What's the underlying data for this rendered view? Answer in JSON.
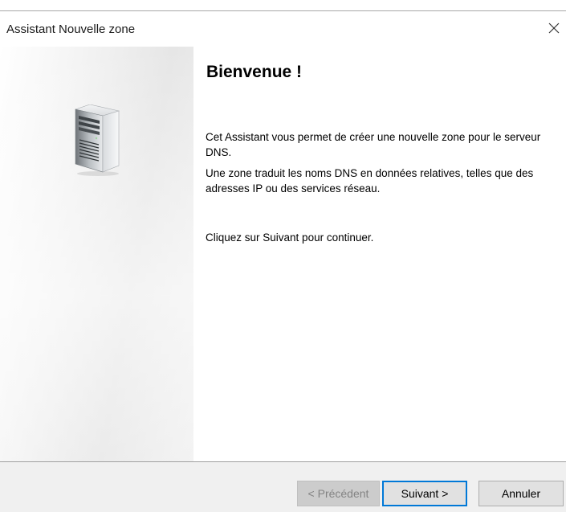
{
  "window": {
    "title": "Assistant Nouvelle zone",
    "close_icon": "close-icon"
  },
  "side_panel": {
    "icon": "server-tower-icon"
  },
  "content": {
    "heading": "Bienvenue !",
    "paragraph_1": "Cet Assistant vous permet de créer une nouvelle zone pour le serveur DNS.",
    "paragraph_2": "Une zone traduit les noms DNS en données relatives, telles que des adresses IP ou des services réseau.",
    "paragraph_3": "Cliquez sur Suivant pour continuer."
  },
  "buttons": {
    "previous": {
      "label": "< Précédent",
      "enabled": false
    },
    "next": {
      "label": "Suivant >",
      "enabled": true,
      "default": true
    },
    "cancel": {
      "label": "Annuler",
      "enabled": true
    }
  },
  "colors": {
    "focus_border": "#0078d7",
    "footer_background": "#f0f0f0",
    "disabled_text": "#838383"
  }
}
